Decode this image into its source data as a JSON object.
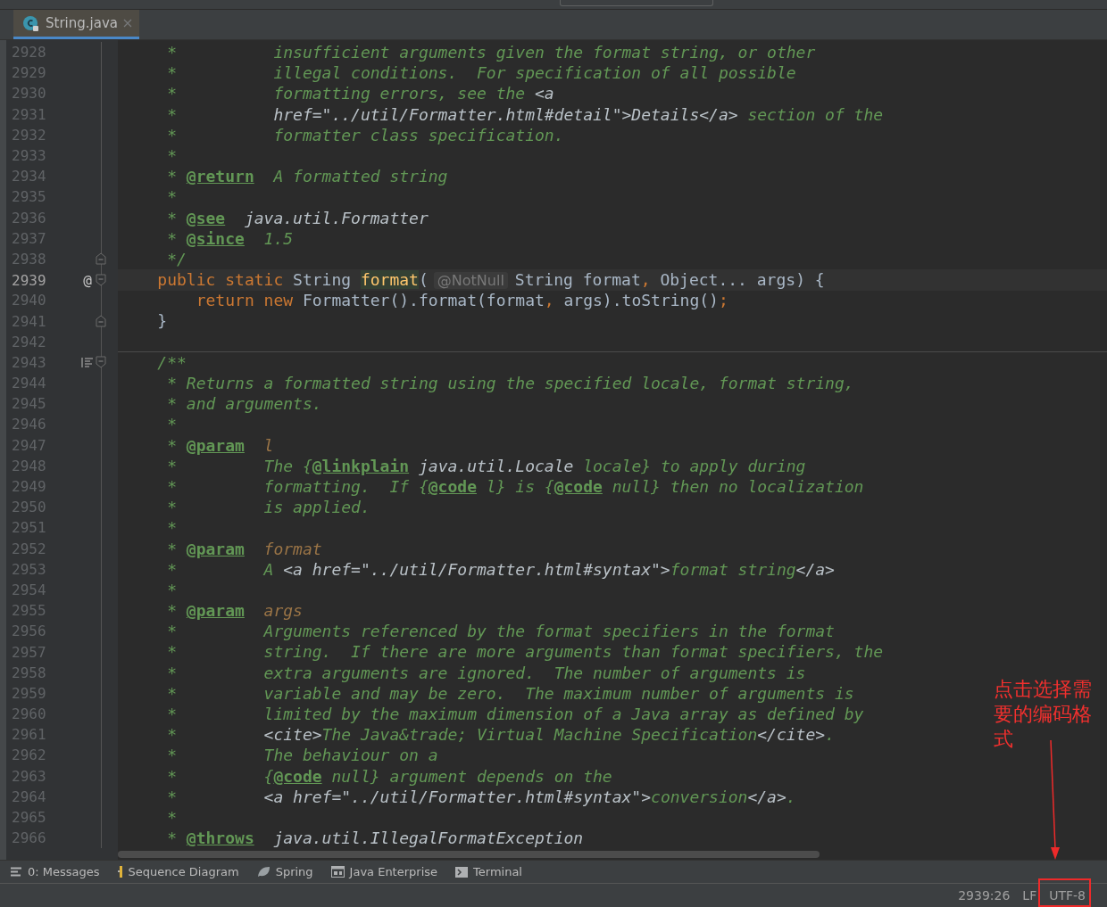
{
  "tabs": [
    {
      "label": "String.java",
      "selected": true
    }
  ],
  "editor": {
    "lines": [
      {
        "number": "2928",
        "current": false,
        "separator": false,
        "tokens": [
          {
            "kind": "comment",
            "text": "     *          insufficient arguments given the format string, or other"
          }
        ]
      },
      {
        "number": "2929",
        "current": false,
        "separator": false,
        "tokens": [
          {
            "kind": "comment",
            "text": "     *          illegal conditions.  For specification of all possible"
          }
        ]
      },
      {
        "number": "2930",
        "current": false,
        "separator": false,
        "tokens": [
          {
            "kind": "comment",
            "text": "     *          formatting errors, see the "
          },
          {
            "kind": "markup",
            "text": "<a"
          }
        ]
      },
      {
        "number": "2931",
        "current": false,
        "separator": false,
        "tokens": [
          {
            "kind": "comment",
            "text": "     *          "
          },
          {
            "kind": "markup",
            "text": "href=\"../util/Formatter.html#detail\">Details</a>"
          },
          {
            "kind": "comment",
            "text": " section of the"
          }
        ]
      },
      {
        "number": "2932",
        "current": false,
        "separator": false,
        "tokens": [
          {
            "kind": "comment",
            "text": "     *          formatter class specification."
          }
        ]
      },
      {
        "number": "2933",
        "current": false,
        "separator": false,
        "tokens": [
          {
            "kind": "comment",
            "text": "     *"
          }
        ]
      },
      {
        "number": "2934",
        "current": false,
        "separator": false,
        "tokens": [
          {
            "kind": "comment",
            "text": "     * "
          },
          {
            "kind": "tag",
            "text": "@return"
          },
          {
            "kind": "comment",
            "text": "  A formatted string"
          }
        ]
      },
      {
        "number": "2935",
        "current": false,
        "separator": false,
        "tokens": [
          {
            "kind": "comment",
            "text": "     *"
          }
        ]
      },
      {
        "number": "2936",
        "current": false,
        "separator": false,
        "tokens": [
          {
            "kind": "comment",
            "text": "     * "
          },
          {
            "kind": "tag",
            "text": "@see"
          },
          {
            "kind": "markup",
            "text": "  java.util.Formatter"
          }
        ]
      },
      {
        "number": "2937",
        "current": false,
        "separator": false,
        "tokens": [
          {
            "kind": "comment",
            "text": "     * "
          },
          {
            "kind": "tag",
            "text": "@since"
          },
          {
            "kind": "comment",
            "text": "  1.5"
          }
        ]
      },
      {
        "number": "2938",
        "current": false,
        "separator": false,
        "fold_end": true,
        "tokens": [
          {
            "kind": "comment",
            "text": "     */"
          }
        ]
      },
      {
        "number": "2939",
        "current": true,
        "separator": false,
        "fold_start": true,
        "marker": "@",
        "tokens": [
          {
            "kind": "keyword",
            "text": "    public static "
          },
          {
            "kind": "plain",
            "text": "String "
          },
          {
            "kind": "method",
            "text": "format"
          },
          {
            "kind": "plain",
            "text": "("
          },
          {
            "kind": "hint",
            "text": "@NotNull"
          },
          {
            "kind": "plain",
            "text": "String format"
          },
          {
            "kind": "punct",
            "text": ","
          },
          {
            "kind": "plain",
            "text": " Object... args) {"
          }
        ]
      },
      {
        "number": "2940",
        "current": false,
        "separator": false,
        "tokens": [
          {
            "kind": "keyword",
            "text": "        return new "
          },
          {
            "kind": "plain",
            "text": "Formatter().format(format"
          },
          {
            "kind": "punct",
            "text": ","
          },
          {
            "kind": "plain",
            "text": " args).toString()"
          },
          {
            "kind": "punct",
            "text": ";"
          }
        ]
      },
      {
        "number": "2941",
        "current": false,
        "separator": false,
        "fold_end": true,
        "tokens": [
          {
            "kind": "plain",
            "text": "    }"
          }
        ]
      },
      {
        "number": "2942",
        "current": false,
        "separator": true
      },
      {
        "number": "2943",
        "current": false,
        "separator": false,
        "fold_start": true,
        "kind": "javadoc",
        "tokens": [
          {
            "kind": "comment",
            "text": "    /**"
          }
        ]
      },
      {
        "number": "2944",
        "current": false,
        "separator": false,
        "tokens": [
          {
            "kind": "comment",
            "text": "     * Returns a formatted string using the specified locale, format string,"
          }
        ]
      },
      {
        "number": "2945",
        "current": false,
        "separator": false,
        "tokens": [
          {
            "kind": "comment",
            "text": "     * and arguments."
          }
        ]
      },
      {
        "number": "2946",
        "current": false,
        "separator": false,
        "tokens": [
          {
            "kind": "comment",
            "text": "     *"
          }
        ]
      },
      {
        "number": "2947",
        "current": false,
        "separator": false,
        "tokens": [
          {
            "kind": "comment",
            "text": "     * "
          },
          {
            "kind": "tag",
            "text": "@param"
          },
          {
            "kind": "param",
            "text": "  l"
          }
        ]
      },
      {
        "number": "2948",
        "current": false,
        "separator": false,
        "tokens": [
          {
            "kind": "comment",
            "text": "     *         The {"
          },
          {
            "kind": "tag",
            "text": "@linkplain"
          },
          {
            "kind": "markup",
            "text": " java.util.Locale"
          },
          {
            "kind": "comment",
            "text": " locale} to apply during"
          }
        ]
      },
      {
        "number": "2949",
        "current": false,
        "separator": false,
        "tokens": [
          {
            "kind": "comment",
            "text": "     *         formatting.  If {"
          },
          {
            "kind": "tag",
            "text": "@code"
          },
          {
            "kind": "comment",
            "text": " l} is {"
          },
          {
            "kind": "tag",
            "text": "@code"
          },
          {
            "kind": "comment",
            "text": " null} then no localization"
          }
        ]
      },
      {
        "number": "2950",
        "current": false,
        "separator": false,
        "tokens": [
          {
            "kind": "comment",
            "text": "     *         is applied."
          }
        ]
      },
      {
        "number": "2951",
        "current": false,
        "separator": false,
        "tokens": [
          {
            "kind": "comment",
            "text": "     *"
          }
        ]
      },
      {
        "number": "2952",
        "current": false,
        "separator": false,
        "tokens": [
          {
            "kind": "comment",
            "text": "     * "
          },
          {
            "kind": "tag",
            "text": "@param"
          },
          {
            "kind": "param",
            "text": "  format"
          }
        ]
      },
      {
        "number": "2953",
        "current": false,
        "separator": false,
        "tokens": [
          {
            "kind": "comment",
            "text": "     *         A "
          },
          {
            "kind": "markup",
            "text": "<a href=\"../util/Formatter.html#syntax\">"
          },
          {
            "kind": "comment",
            "text": "format string"
          },
          {
            "kind": "markup",
            "text": "</a>"
          }
        ]
      },
      {
        "number": "2954",
        "current": false,
        "separator": false,
        "tokens": [
          {
            "kind": "comment",
            "text": "     *"
          }
        ]
      },
      {
        "number": "2955",
        "current": false,
        "separator": false,
        "tokens": [
          {
            "kind": "comment",
            "text": "     * "
          },
          {
            "kind": "tag",
            "text": "@param"
          },
          {
            "kind": "param",
            "text": "  args"
          }
        ]
      },
      {
        "number": "2956",
        "current": false,
        "separator": false,
        "tokens": [
          {
            "kind": "comment",
            "text": "     *         Arguments referenced by the format specifiers in the format"
          }
        ]
      },
      {
        "number": "2957",
        "current": false,
        "separator": false,
        "tokens": [
          {
            "kind": "comment",
            "text": "     *         string.  If there are more arguments than format specifiers, the"
          }
        ]
      },
      {
        "number": "2958",
        "current": false,
        "separator": false,
        "tokens": [
          {
            "kind": "comment",
            "text": "     *         extra arguments are ignored.  The number of arguments is"
          }
        ]
      },
      {
        "number": "2959",
        "current": false,
        "separator": false,
        "tokens": [
          {
            "kind": "comment",
            "text": "     *         variable and may be zero.  The maximum number of arguments is"
          }
        ]
      },
      {
        "number": "2960",
        "current": false,
        "separator": false,
        "tokens": [
          {
            "kind": "comment",
            "text": "     *         limited by the maximum dimension of a Java array as defined by"
          }
        ]
      },
      {
        "number": "2961",
        "current": false,
        "separator": false,
        "tokens": [
          {
            "kind": "comment",
            "text": "     *         "
          },
          {
            "kind": "markup",
            "text": "<cite>"
          },
          {
            "kind": "comment",
            "text": "The Java&trade; Virtual Machine Specification"
          },
          {
            "kind": "markup",
            "text": "</cite>"
          },
          {
            "kind": "comment",
            "text": "."
          }
        ]
      },
      {
        "number": "2962",
        "current": false,
        "separator": false,
        "tokens": [
          {
            "kind": "comment",
            "text": "     *         The behaviour on a"
          }
        ]
      },
      {
        "number": "2963",
        "current": false,
        "separator": false,
        "tokens": [
          {
            "kind": "comment",
            "text": "     *         {"
          },
          {
            "kind": "tag",
            "text": "@code"
          },
          {
            "kind": "comment",
            "text": " null} argument depends on the"
          }
        ]
      },
      {
        "number": "2964",
        "current": false,
        "separator": false,
        "tokens": [
          {
            "kind": "comment",
            "text": "     *         "
          },
          {
            "kind": "markup",
            "text": "<a href=\"../util/Formatter.html#syntax\">"
          },
          {
            "kind": "comment",
            "text": "conversion"
          },
          {
            "kind": "markup",
            "text": "</a>"
          },
          {
            "kind": "comment",
            "text": "."
          }
        ]
      },
      {
        "number": "2965",
        "current": false,
        "separator": false,
        "tokens": [
          {
            "kind": "comment",
            "text": "     *"
          }
        ]
      },
      {
        "number": "2966",
        "current": false,
        "separator": false,
        "tokens": [
          {
            "kind": "comment",
            "text": "     * "
          },
          {
            "kind": "tag",
            "text": "@throws"
          },
          {
            "kind": "markup",
            "text": "  java.util.IllegalFormatException"
          }
        ]
      }
    ]
  },
  "tool_windows": [
    {
      "label": "0: Messages",
      "kind": "messages"
    },
    {
      "label": "Sequence Diagram",
      "kind": "sequence"
    },
    {
      "label": "Spring",
      "kind": "spring"
    },
    {
      "label": "Java Enterprise",
      "kind": "enterprise"
    },
    {
      "label": "Terminal",
      "kind": "terminal"
    }
  ],
  "status_bar": [
    "2939:26",
    "LF",
    "UTF-8"
  ],
  "annotation": {
    "text": "点击选择需要的编码格式"
  }
}
